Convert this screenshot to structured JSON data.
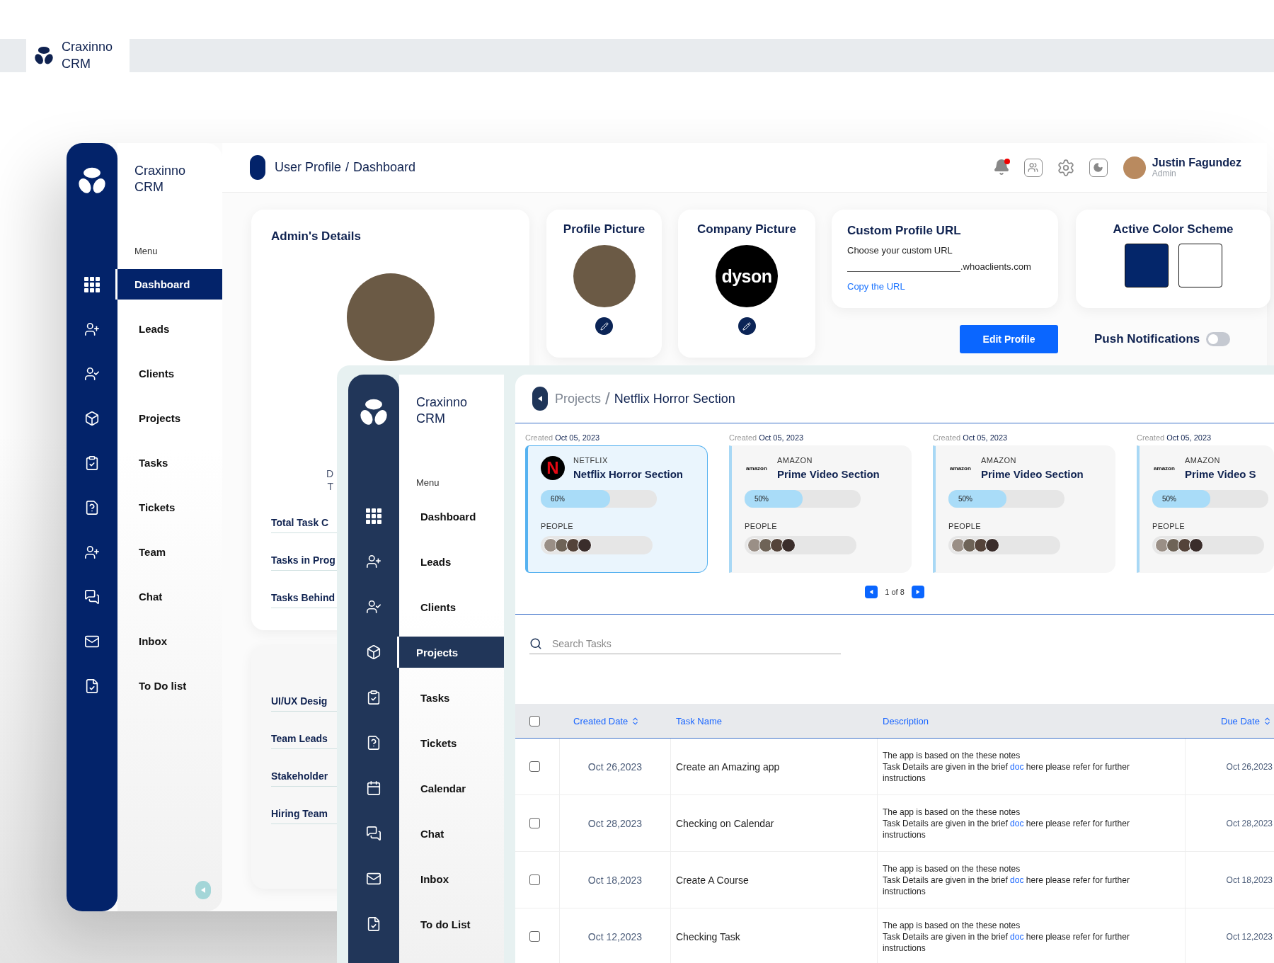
{
  "top_bar": {
    "brand": "Craxinno CRM"
  },
  "back_window": {
    "sidebar": {
      "brand": "Craxinno CRM",
      "menu_label": "Menu",
      "items": [
        {
          "label": "Dashboard",
          "selected": true
        },
        {
          "label": "Leads",
          "selected": false
        },
        {
          "label": "Clients",
          "selected": false
        },
        {
          "label": "Projects",
          "selected": false
        },
        {
          "label": "Tasks",
          "selected": false
        },
        {
          "label": "Tickets",
          "selected": false
        },
        {
          "label": "Team",
          "selected": false
        },
        {
          "label": "Chat",
          "selected": false
        },
        {
          "label": "Inbox",
          "selected": false
        },
        {
          "label": "To Do list",
          "selected": false
        }
      ]
    },
    "breadcrumb": {
      "items": [
        "User Profile",
        "Dashboard"
      ],
      "separator": "/"
    },
    "header": {
      "notifications_unread": true,
      "user_name": "Justin Fagundez",
      "user_role": "Admin"
    },
    "admin_card": {
      "title": "Admin's Details",
      "fragments": [
        "D",
        "T"
      ],
      "stats": [
        "Total Task C",
        "Tasks in Prog",
        "Tasks Behind"
      ]
    },
    "groups_card": {
      "items": [
        "UI/UX Desig",
        "Team Leads",
        "Stakeholder",
        "Hiring Team"
      ]
    },
    "profile_picture": {
      "title": "Profile Picture"
    },
    "company_picture": {
      "title": "Company Picture",
      "logo_text": "dyson"
    },
    "custom_url": {
      "title": "Custom Profile URL",
      "hint": "Choose your custom URL",
      "domain": ".whoaclients.com",
      "link": "Copy the URL"
    },
    "color_scheme": {
      "title": "Active Color Scheme",
      "swatches": [
        {
          "color": "#04266a"
        },
        {
          "color": "#ffffff"
        }
      ]
    },
    "edit_button": "Edit Profile",
    "push_notifications": {
      "label": "Push Notifications",
      "on": false
    }
  },
  "front_window": {
    "sidebar": {
      "brand": "Craxinno CRM",
      "menu_label": "Menu",
      "items": [
        {
          "label": "Dashboard",
          "selected": false
        },
        {
          "label": "Leads",
          "selected": false
        },
        {
          "label": "Clients",
          "selected": false
        },
        {
          "label": "Projects",
          "selected": true
        },
        {
          "label": "Tasks",
          "selected": false
        },
        {
          "label": "Tickets",
          "selected": false
        },
        {
          "label": "Calendar",
          "selected": false
        },
        {
          "label": "Chat",
          "selected": false
        },
        {
          "label": "Inbox",
          "selected": false
        },
        {
          "label": "To do List",
          "selected": false
        }
      ]
    },
    "breadcrumb": {
      "parent": "Projects",
      "separator": "/",
      "current": "Netflix Horror Section"
    },
    "projects": [
      {
        "created_label": "Created",
        "created_date": "Oct 05, 2023",
        "kind": "netflix",
        "logo_text": "N",
        "brand": "NETFLIX",
        "title": "Netflix Horror Section",
        "level": 0.6,
        "progress": "60%",
        "people_label": "PEOPLE",
        "selected": true
      },
      {
        "created_label": "Created",
        "created_date": "Oct 05, 2023",
        "kind": "amazon",
        "logo_text": "amazon",
        "brand": "AMAZON",
        "title": "Prime Video Section",
        "level": 0.5,
        "progress": "50%",
        "people_label": "PEOPLE",
        "selected": false
      },
      {
        "created_label": "Created",
        "created_date": "Oct 05, 2023",
        "kind": "amazon",
        "logo_text": "amazon",
        "brand": "AMAZON",
        "title": "Prime Video Section",
        "level": 0.5,
        "progress": "50%",
        "people_label": "PEOPLE",
        "selected": false
      },
      {
        "created_label": "Created",
        "created_date": "Oct 05, 2023",
        "kind": "amazon",
        "logo_text": "amazon",
        "brand": "AMAZON",
        "title": "Prime Video S",
        "level": 0.5,
        "progress": "50%",
        "people_label": "PEOPLE",
        "selected": false
      }
    ],
    "pagination": {
      "page": "1 of 8"
    },
    "search": {
      "placeholder": "Search Tasks"
    },
    "table": {
      "select_all_checked": false,
      "columns": [
        {
          "label": "Created Date",
          "sortable": true
        },
        {
          "label": "Task Name",
          "sortable": false
        },
        {
          "label": "Description",
          "sortable": false
        },
        {
          "label": "Due Date",
          "sortable": true
        }
      ],
      "rows": [
        {
          "checked": false,
          "created": "Oct 26,2023",
          "task": "Create an Amazing app",
          "note": "The app is based on the these notes",
          "details": "Task Details are given in the brief",
          "link": "doc",
          "details_end": "here please refer for further instructions",
          "due": "Oct 26,2023"
        },
        {
          "checked": false,
          "created": "Oct 28,2023",
          "task": "Checking on Calendar",
          "note": "The app is based on the these notes",
          "details": "Task Details are given in the brief",
          "link": "doc",
          "details_end": "here please refer for further instructions",
          "due": "Oct 28,2023"
        },
        {
          "checked": false,
          "created": "Oct 18,2023",
          "task": "Create A Course",
          "note": "The app is based on the these notes",
          "details": "Task Details are given in the brief",
          "link": "doc",
          "details_end": "here please refer for further instructions",
          "due": "Oct 18,2023"
        },
        {
          "checked": false,
          "created": "Oct 12,2023",
          "task": "Checking Task",
          "note": "The app is based on the these notes",
          "details": "Task Details are given in the brief",
          "link": "doc",
          "details_end": "here please refer for further instructions",
          "due": "Oct 12,2023"
        }
      ]
    }
  }
}
